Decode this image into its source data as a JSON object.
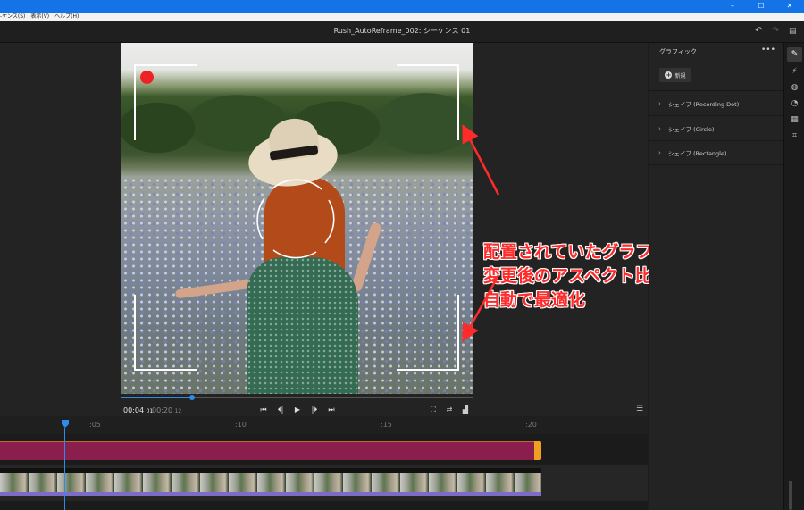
{
  "window": {
    "title": "Rush_AutoReframe_002: シーケンス 01",
    "controls": [
      "–",
      "☐",
      "✕"
    ]
  },
  "menu": [
    "-ケンス(S)",
    "表示(V)",
    "ヘルプ(H)"
  ],
  "player": {
    "current_time": "00:04",
    "current_frames": "01",
    "duration": "00:20",
    "duration_frames": "12",
    "progress": 0.2,
    "transport": [
      "⏮",
      "⏴|",
      "▶",
      "|⏵",
      "⏭"
    ]
  },
  "annotation": {
    "lines": [
      "配置されていたグラフィックが",
      "変更後のアスペクト比にあわせて",
      "自動で最適化"
    ],
    "color": "#ff2a2a"
  },
  "timeline": {
    "ruler_labels": [
      ":05",
      ":10",
      ":15",
      ":20"
    ],
    "playhead_color": "#2d8ceb",
    "graphics_track_color": "#8a1f4d"
  },
  "panel": {
    "title": "グラフィック",
    "more": "•••",
    "new_label": "新規",
    "shapes": [
      "シェイプ (Recording Dot)",
      "シェイプ (Circle)",
      "シェイプ (Rectangle)"
    ]
  },
  "rail_icons": [
    "graphics-icon",
    "effects-icon",
    "color-icon",
    "speed-icon",
    "audio-icon",
    "crop-icon"
  ],
  "colors": {
    "accent": "#2d8ceb",
    "recording_dot": "#ee2222",
    "titlebar": "#1473e6"
  }
}
